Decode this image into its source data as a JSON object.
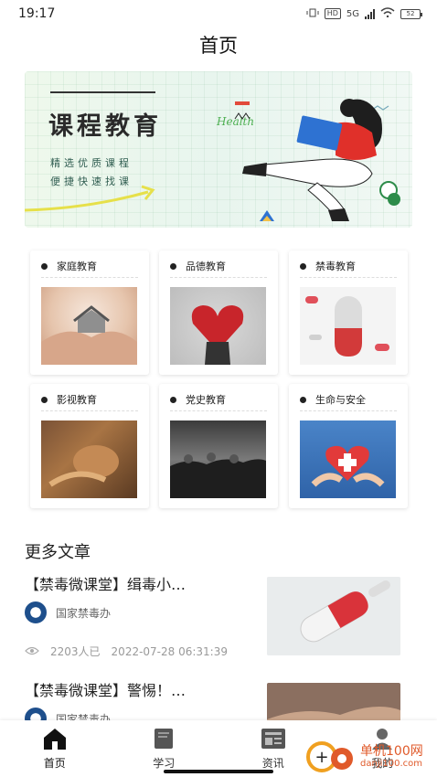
{
  "status_bar": {
    "time": "19:17",
    "hd": "HD",
    "network": "5G",
    "battery": "52"
  },
  "page_title": "首页",
  "banner": {
    "title": "课程教育",
    "script_text": "Health",
    "subtitle_line1": "精选优质课程",
    "subtitle_line2": "便捷快速找课"
  },
  "categories": [
    {
      "label": "家庭教育",
      "image": "hands-holding-house"
    },
    {
      "label": "品德教育",
      "image": "red-heart"
    },
    {
      "label": "禁毒教育",
      "image": "capsule-pills"
    },
    {
      "label": "影视教育",
      "image": "pottery-hands"
    },
    {
      "label": "党史教育",
      "image": "soldiers-photo"
    },
    {
      "label": "生命与安全",
      "image": "heart-first-aid"
    }
  ],
  "more_articles": {
    "section_title": "更多文章",
    "items": [
      {
        "title": "【禁毒微课堂】缉毒小…",
        "source": "国家禁毒办",
        "views": "2203人已",
        "date": "2022-07-28 06:31:39",
        "thumb": "capsule-pill"
      },
      {
        "title": "【禁毒微课堂】警惕！…",
        "source": "国家禁毒办",
        "views": "",
        "date": "",
        "thumb": "hands"
      }
    ]
  },
  "bottom_nav": [
    {
      "label": "首页",
      "icon": "home-icon",
      "active": true
    },
    {
      "label": "学习",
      "icon": "book-icon",
      "active": false
    },
    {
      "label": "资讯",
      "icon": "news-icon",
      "active": false
    },
    {
      "label": "我的",
      "icon": "profile-icon",
      "active": false
    }
  ],
  "watermark": {
    "text": "单机100网",
    "sub": "danji100.com"
  },
  "colors": {
    "accent": "#e24a3b",
    "green": "#4caf50",
    "nav_active": "#111111"
  }
}
